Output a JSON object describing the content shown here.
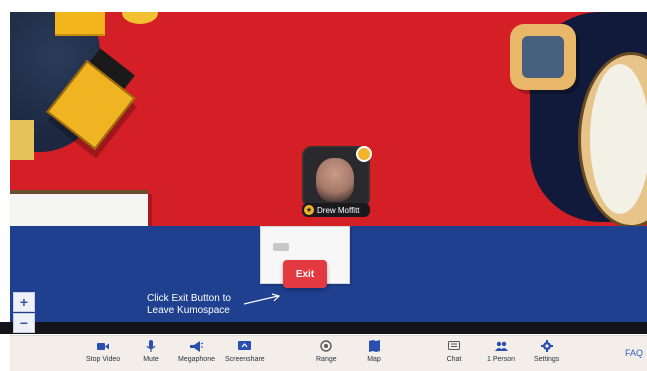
{
  "map": {
    "exit_button_label": "Exit",
    "participant_name": "Drew Moffitt",
    "annotation_line1": "Click Exit Button to",
    "annotation_line2": "Leave Kumospace"
  },
  "zoom": {
    "zoom_in_label": "+",
    "zoom_out_label": "−"
  },
  "toolbar": {
    "items": [
      {
        "label": "Stop Video",
        "icon": "video-camera-icon"
      },
      {
        "label": "Mute",
        "icon": "microphone-icon"
      },
      {
        "label": "Megaphone",
        "icon": "megaphone-icon"
      },
      {
        "label": "Screenshare",
        "icon": "screenshare-icon"
      },
      {
        "label": "Range",
        "icon": "range-icon"
      },
      {
        "label": "Map",
        "icon": "map-icon"
      },
      {
        "label": "Chat",
        "icon": "chat-icon"
      },
      {
        "label": "1 Person",
        "icon": "people-icon"
      },
      {
        "label": "Settings",
        "icon": "gear-icon"
      }
    ],
    "faq_label": "FAQ"
  },
  "colors": {
    "red_carpet": "#d41f26",
    "blue_carpet": "#1f3f8f",
    "exit_button": "#e33a42",
    "toolbar_bg": "#f3eee9",
    "toolbar_icon": "#2b4fb0"
  }
}
